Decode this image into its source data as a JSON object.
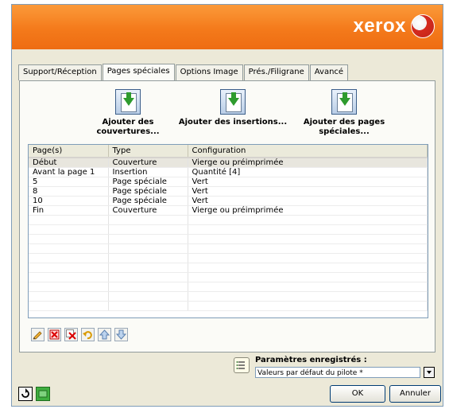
{
  "brand": {
    "logo_text": "xerox",
    "accent_color": "#f47a1b"
  },
  "tabs": [
    {
      "label": "Support/Réception",
      "active": false
    },
    {
      "label": "Pages spéciales",
      "active": true
    },
    {
      "label": "Options Image",
      "active": false
    },
    {
      "label": "Prés./Filigrane",
      "active": false
    },
    {
      "label": "Avancé",
      "active": false
    }
  ],
  "actions": {
    "add_covers": {
      "line1": "Ajouter des",
      "line2": "couvertures..."
    },
    "add_inserts": {
      "line1": "Ajouter des insertions...",
      "line2": ""
    },
    "add_special": {
      "line1": "Ajouter des pages",
      "line2": "spéciales..."
    }
  },
  "grid": {
    "columns": [
      "Page(s)",
      "Type",
      "Configuration"
    ],
    "rows": [
      {
        "page": "Début",
        "type": "Couverture",
        "config": "Vierge ou préimprimée",
        "selected": true
      },
      {
        "page": "Avant la page 1",
        "type": "Insertion",
        "config": "Quantité [4]",
        "selected": false
      },
      {
        "page": "5",
        "type": "Page spéciale",
        "config": "Vert",
        "selected": false
      },
      {
        "page": "8",
        "type": "Page spéciale",
        "config": "Vert",
        "selected": false
      },
      {
        "page": "10",
        "type": "Page spéciale",
        "config": "Vert",
        "selected": false
      },
      {
        "page": "Fin",
        "type": "Couverture",
        "config": "Vierge ou préimprimée",
        "selected": false
      }
    ]
  },
  "toolbar_icons": [
    "edit-icon",
    "delete-icon",
    "delete-all-icon",
    "undo-icon",
    "move-up-icon",
    "move-down-icon"
  ],
  "saved_settings": {
    "label": "Paramètres enregistrés :",
    "value": "Valeurs par défaut du pilote *"
  },
  "buttons": {
    "ok": "OK",
    "cancel": "Annuler"
  }
}
